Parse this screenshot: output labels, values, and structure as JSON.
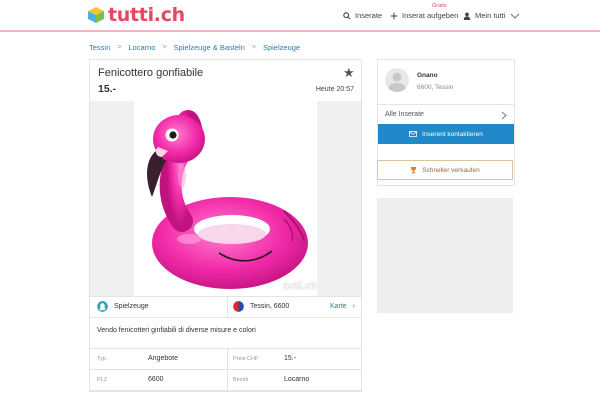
{
  "header": {
    "logo_text": "tutti.ch",
    "nav": {
      "search": "Inserate",
      "post": "Inserat aufgeben",
      "post_badge": "Gratis",
      "account": "Mein tutti"
    },
    "accent_color": "#e8485f"
  },
  "breadcrumb": [
    "Tessin",
    "Locarno",
    "Spielzeuge & Basteln",
    "Spielzeuge"
  ],
  "listing": {
    "title": "Fenicottero gonfiabile",
    "price": "15.-",
    "date": "Heute 20:57",
    "watermark": "tutti.ch",
    "category": "Spielzeuge",
    "location": "Tessin, 6600",
    "map_link": "Karte",
    "description": "Vendo fenicotteri ginfiabili di diverse misure e colori",
    "details": [
      {
        "label1": "Typ",
        "value1": "Angebote",
        "label2": "Preis CHF",
        "value2": "15.-"
      },
      {
        "label1": "PLZ",
        "value1": "6600",
        "label2": "Bezirk",
        "value2": "Locarno"
      }
    ]
  },
  "seller": {
    "name": "Gnano",
    "location": "6600, Tessin",
    "all_ads": "Alle Inserate",
    "contact_button": "Inserent kontaktieren",
    "sell_faster": "Schneller verkaufen",
    "button_color": "#2188c9"
  }
}
